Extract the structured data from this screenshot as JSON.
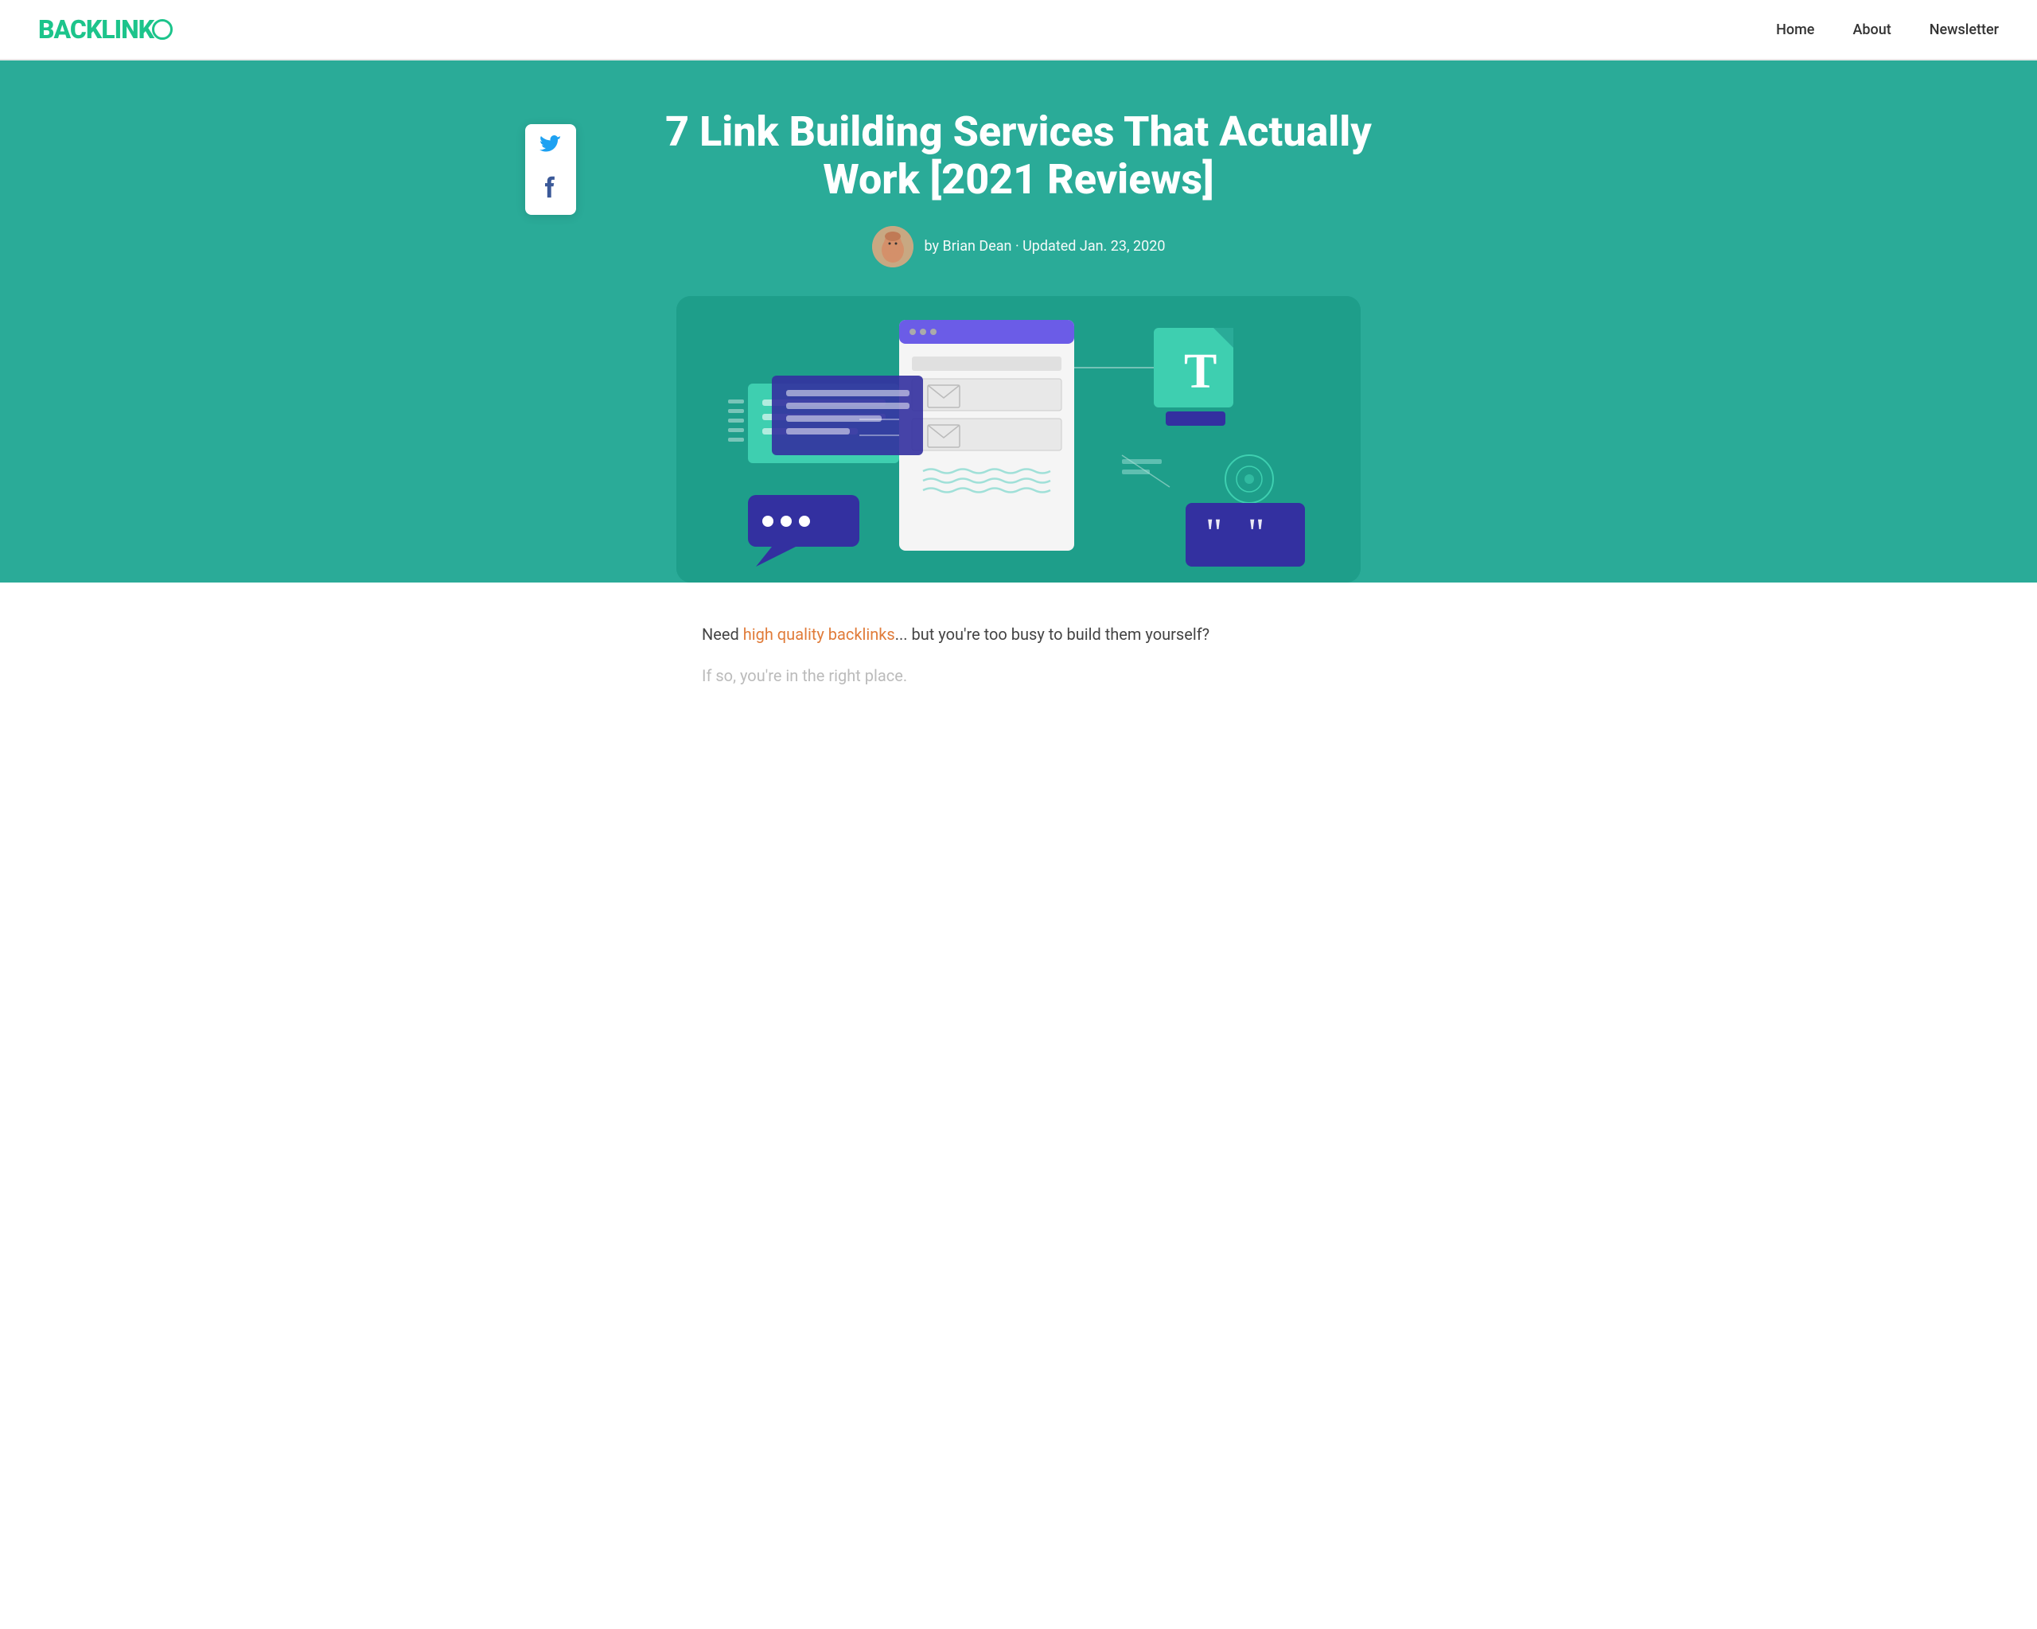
{
  "brand": {
    "name": "BACKLINKO",
    "logo_text": "BACKLINK",
    "logo_o": "O"
  },
  "nav": {
    "links": [
      {
        "label": "Home",
        "href": "#"
      },
      {
        "label": "About",
        "href": "#"
      },
      {
        "label": "Newsletter",
        "href": "#"
      }
    ]
  },
  "hero": {
    "title": "7 Link Building Services That Actually Work [2021 Reviews]",
    "author": "by Brian Dean · Updated Jan. 23, 2020"
  },
  "social": {
    "twitter_label": "Twitter",
    "facebook_label": "Facebook"
  },
  "content": {
    "intro_link_text": "high quality backlinks",
    "intro_text_before": "Need ",
    "intro_text_after": "... but you're too busy to build them yourself?",
    "subtext": "If so, you're in the right place."
  }
}
